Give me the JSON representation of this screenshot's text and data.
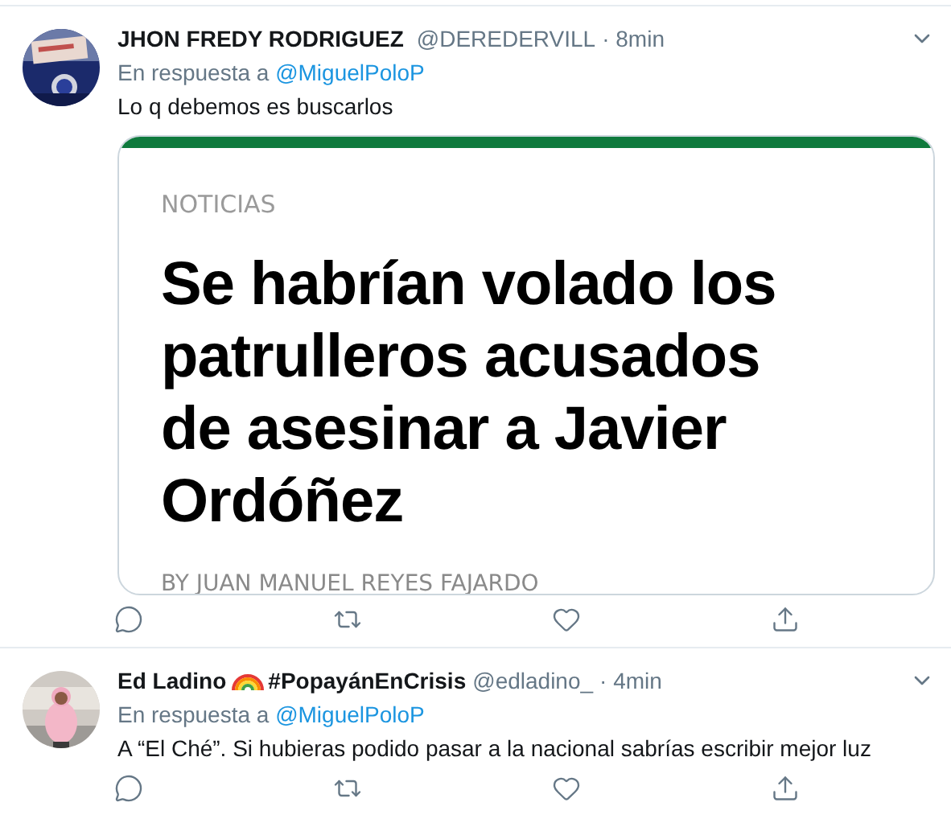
{
  "tweets": [
    {
      "name": "JHON FREDY RODRIGUEZ",
      "handle": "@DEREDERVILL",
      "time": "· 8min",
      "reply_prefix": "En respuesta a",
      "reply_to": "@MiguelPoloP",
      "text": "Lo q debemos es buscarlos",
      "card": {
        "section": "NOTICIAS",
        "headline_lines": [
          "Se habrían volado los",
          "patrulleros acusados",
          "de asesinar a Javier",
          "Ordóñez"
        ],
        "byline": "BY JUAN MANUEL REYES FAJARDO"
      }
    },
    {
      "name": "Ed Ladino",
      "name_suffix": "#PopayánEnCrisis",
      "handle": "@edladino_",
      "time": "· 4min",
      "reply_prefix": "En respuesta a",
      "reply_to": "@MiguelPoloP",
      "text": "A “El Ché”. Si hubieras podido pasar a la nacional sabrías escribir mejor luz"
    }
  ]
}
